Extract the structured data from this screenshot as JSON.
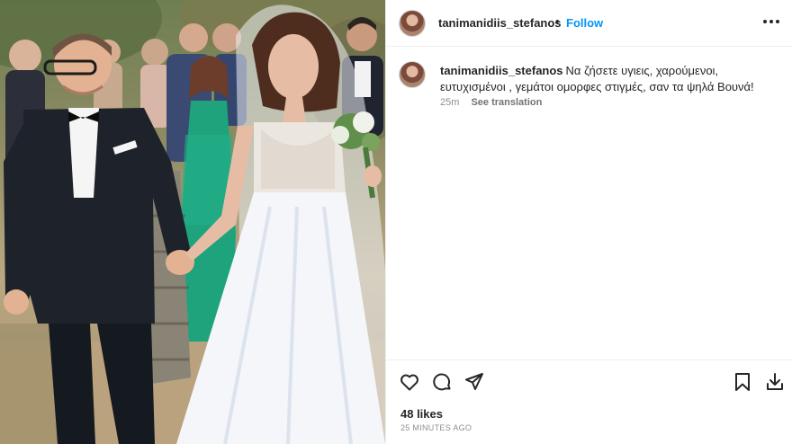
{
  "post": {
    "image_alt": "Wedding photo: groom in black tuxedo holding hands with bride in white gown, guests behind",
    "username": "tanimanidiis_stefanos",
    "separator": "•",
    "follow_label": "Follow",
    "more_icon": "more-horizontal-icon",
    "caption": {
      "username": "tanimanidiis_stefanos",
      "text": "Να ζήσετε υγιεις, χαρούμενοι, ευτυχισμένοι , γεμάτοι ομορφες στιγμές, σαν τα ψηλά Βουνά!",
      "time": "25m",
      "translate_label": "See translation"
    },
    "actions": {
      "like_icon": "heart-icon",
      "comment_icon": "comment-icon",
      "share_icon": "send-icon",
      "save_icon": "bookmark-icon",
      "download_icon": "download-icon"
    },
    "likes": "48 likes",
    "timestamp": "25 MINUTES AGO"
  },
  "colors": {
    "accent": "#0095f6",
    "text": "#262626",
    "muted": "#8e8e8e",
    "border": "#efefef"
  }
}
